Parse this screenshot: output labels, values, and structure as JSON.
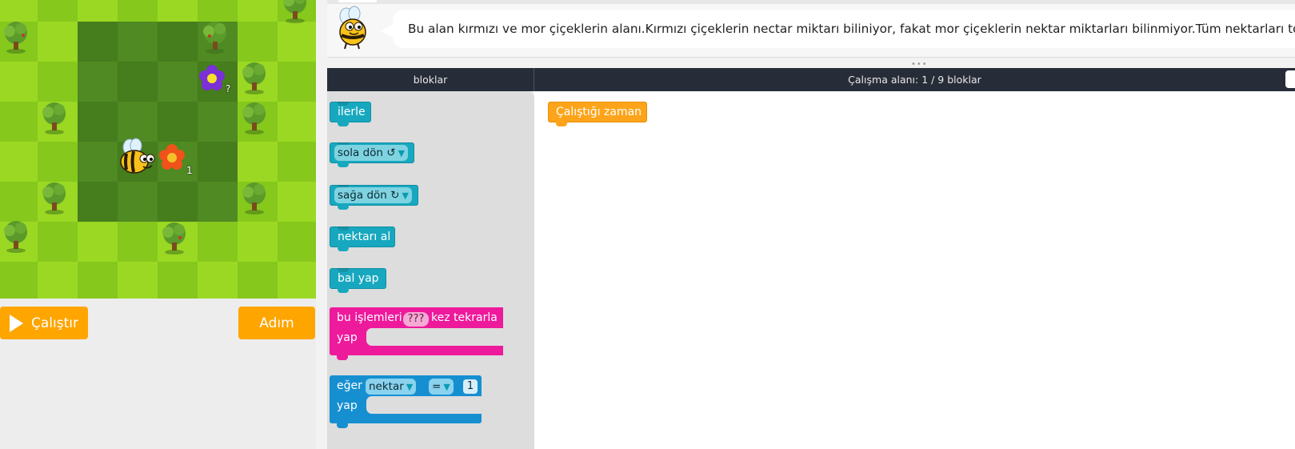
{
  "instructions": {
    "text": "Bu alan kırmızı ve mor çiçeklerin alanı.Kırmızı çiçeklerin nectar miktarı biliniyor, fakat mor çiçeklerin nektar miktarları bilinmiyor.Tüm nektarları topla."
  },
  "game": {
    "red_flower_nectar": "1",
    "purple_flower_nectar": "?"
  },
  "controls": {
    "run_label": "Çalıştır",
    "step_label": "Adım"
  },
  "headers": {
    "toolbox": "bloklar",
    "workspace": "Çalışma alanı: 1 / 9 bloklar"
  },
  "toolbox": {
    "move_forward": "ilerle",
    "turn_left": "sola dön ↺",
    "turn_right": "sağa dön ↻",
    "get_nectar": "nektarı al",
    "make_honey": "bal yap",
    "repeat_prefix": "bu işlemleri",
    "repeat_count": "???",
    "repeat_suffix": "kez tekrarla",
    "repeat_do": "yap",
    "if_label": "eğer",
    "if_variable": "nektar",
    "if_operator": "=",
    "if_value": "1",
    "if_do": "yap"
  },
  "workspace": {
    "when_run": "Çalıştığı zaman"
  },
  "colors": {
    "run_button": "#fea500",
    "teal_block": "#17a8bf",
    "pink_block": "#ee1a9c",
    "blue_block": "#168fd1",
    "header_bg": "#272d38"
  }
}
